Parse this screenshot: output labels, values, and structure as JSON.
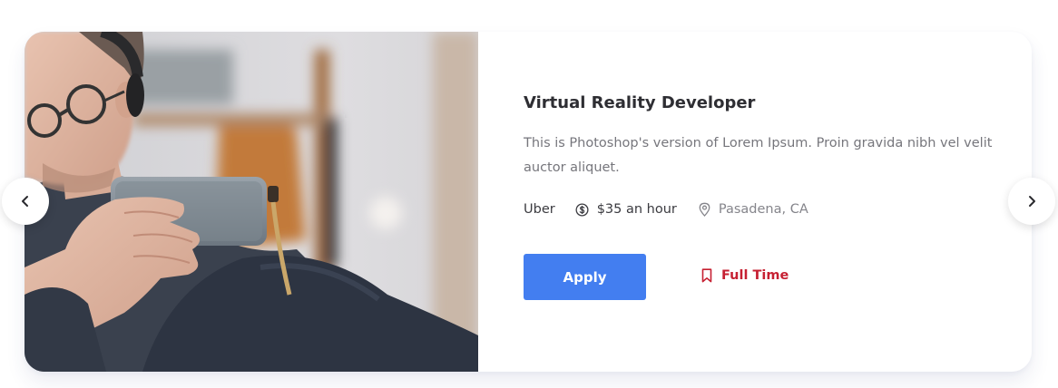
{
  "job": {
    "title": "Virtual Reality Developer",
    "description": "This is Photoshop's version of Lorem Ipsum. Proin gravida nibh vel velit auctor aliquet.",
    "company": "Uber",
    "salary": "$35 an hour",
    "location": "Pasadena, CA",
    "apply_label": "Apply",
    "job_type": "Full Time"
  },
  "icons": {
    "salary": "dollar-circle-icon",
    "location": "map-pin-icon",
    "job_type": "bookmark-icon",
    "prev": "chevron-left-icon",
    "next": "chevron-right-icon"
  },
  "colors": {
    "accent": "#437ef0",
    "job_type": "#c62032",
    "title": "#2e2e33",
    "muted": "#76767c"
  }
}
